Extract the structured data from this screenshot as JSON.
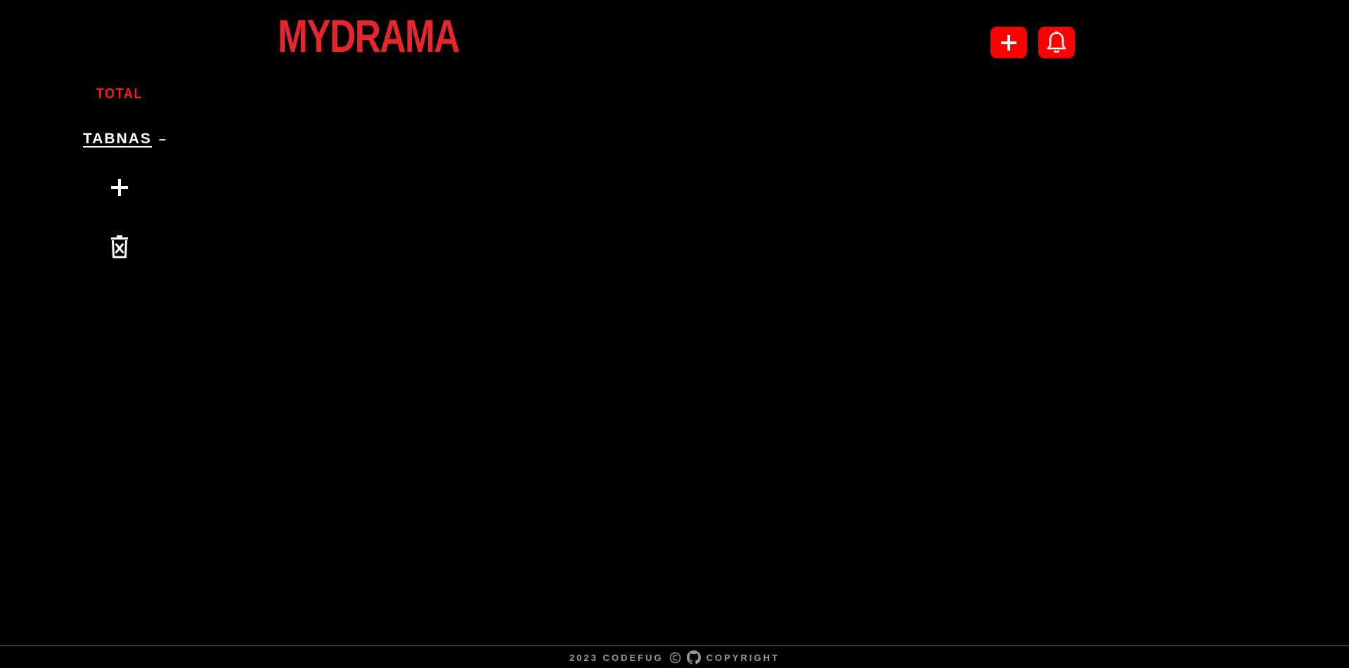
{
  "header": {
    "logo": "MYDRAMA",
    "actions": [
      {
        "icon": "plus-icon"
      },
      {
        "icon": "bell-icon"
      }
    ]
  },
  "sidebar": {
    "total_label": "TOTAL",
    "tab_label": "TABNAS",
    "tab_suffix": "–",
    "add_icon": "plus-icon",
    "delete_icon": "trash-x-icon"
  },
  "footer": {
    "year_author": "2023 CODEFUG",
    "copyright_icon": "copyright-icon",
    "github_icon": "github-icon",
    "copyright_label": "COPYRIGHT"
  },
  "colors": {
    "background": "#000000",
    "accent": "#ff0000",
    "logo": "#e5262d",
    "footer_text": "#9a9a9a"
  }
}
